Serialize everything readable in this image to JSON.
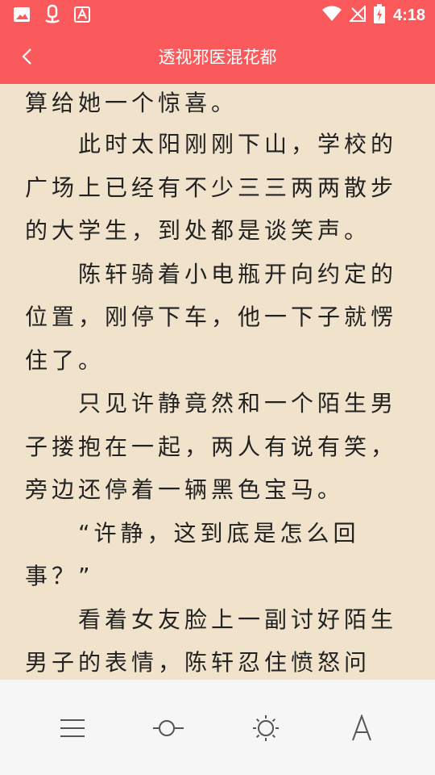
{
  "status_bar": {
    "time": "4:18",
    "icons": [
      "image-icon",
      "bug-app-icon",
      "font-app-icon",
      "wifi-icon",
      "no-signal-icon",
      "battery-charging-icon"
    ],
    "background": "#fb5a5c"
  },
  "app_bar": {
    "title": "透视邪医混花都",
    "back_icon": "chevron-left-icon",
    "background": "#fb5a5c"
  },
  "reader": {
    "background": "#f0e2cb",
    "lines": [
      "算给她一个惊喜。",
      "　　此时太阳刚刚下山，学校的",
      "广场上已经有不少三三两两散步",
      "的大学生，到处都是谈笑声。",
      "　　陈轩骑着小电瓶开向约定的",
      "位置，刚停下车，他一下子就愣",
      "住了。",
      "　　只见许静竟然和一个陌生男",
      "子搂抱在一起，两人有说有笑，",
      "旁边还停着一辆黑色宝马。",
      "　　“许静，这到底是怎么回",
      "事？”",
      "　　看着女友脸上一副讨好陌生",
      "男子的表情，陈轩忍住愤怒问"
    ]
  },
  "toolbar": {
    "buttons": [
      "menu-icon",
      "progress-icon",
      "brightness-icon",
      "font-icon"
    ]
  }
}
